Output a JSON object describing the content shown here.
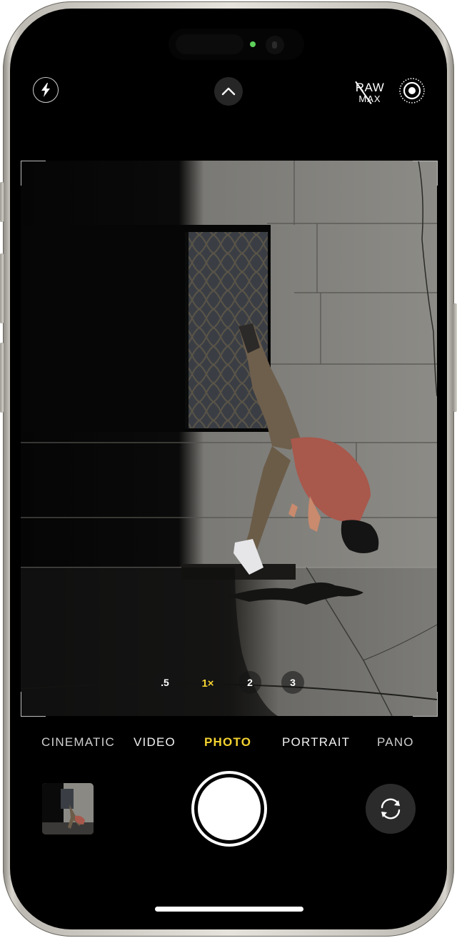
{
  "top_controls": {
    "flash_icon": "flash-icon",
    "expand_controls_icon": "chevron-up-icon",
    "raw_label": "RAW",
    "max_label": "MAX",
    "live_photo_icon": "live-photo-icon"
  },
  "status": {
    "camera_indicator_color": "#5ed05a"
  },
  "zoom_levels": [
    {
      "label": ".5",
      "active": false
    },
    {
      "label": "1×",
      "active": true
    },
    {
      "label": "2",
      "active": false
    },
    {
      "label": "3",
      "active": false
    }
  ],
  "modes": [
    {
      "label": "CINEMATIC",
      "active": false
    },
    {
      "label": "VIDEO",
      "active": false
    },
    {
      "label": "PHOTO",
      "active": true
    },
    {
      "label": "PORTRAIT",
      "active": false
    },
    {
      "label": "PANO",
      "active": false
    }
  ],
  "bottom_controls": {
    "thumbnail": "last-photo-thumbnail",
    "shutter": "shutter-button",
    "flip_icon": "camera-flip-icon"
  },
  "colors": {
    "accent_yellow": "#f5d330",
    "background": "#000000"
  }
}
